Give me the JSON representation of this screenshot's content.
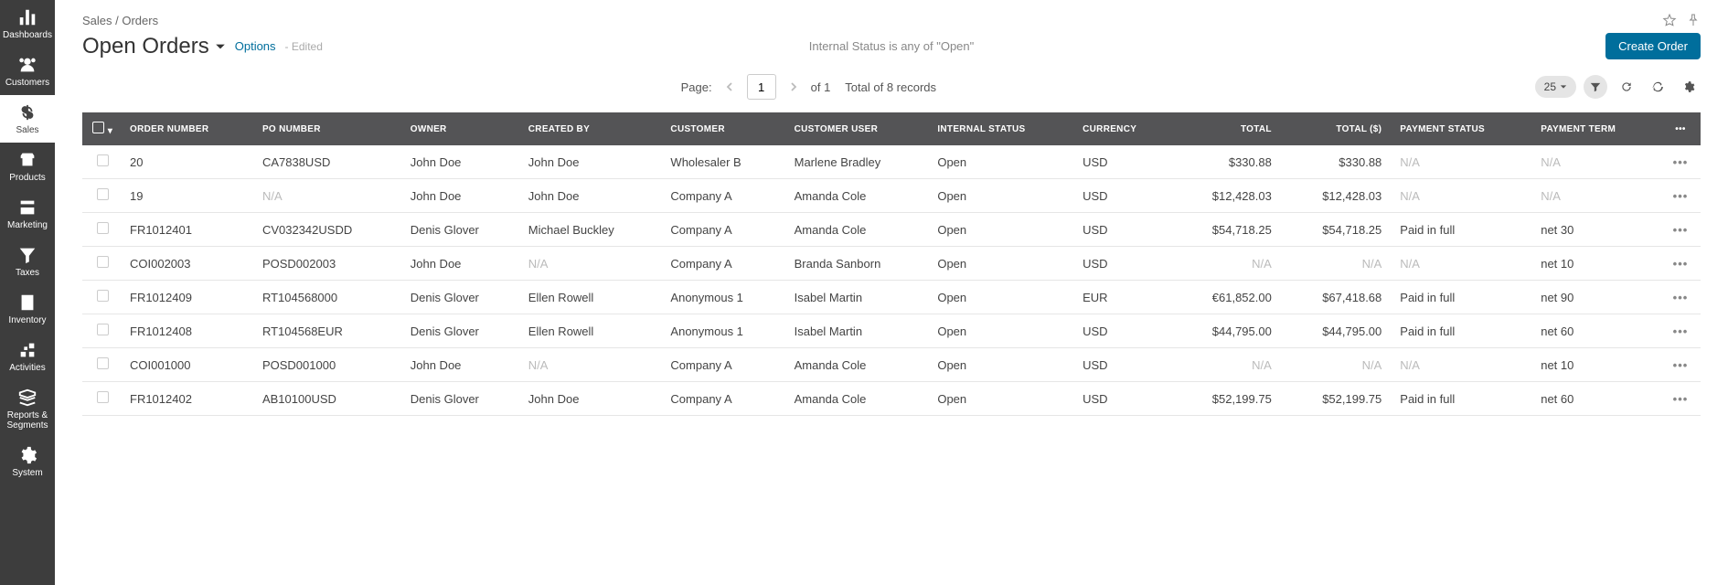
{
  "sidebar": {
    "items": [
      {
        "label": "Dashboards",
        "icon": "dashboards"
      },
      {
        "label": "Customers",
        "icon": "customers"
      },
      {
        "label": "Sales",
        "icon": "sales",
        "active": true
      },
      {
        "label": "Products",
        "icon": "products"
      },
      {
        "label": "Marketing",
        "icon": "marketing"
      },
      {
        "label": "Taxes",
        "icon": "taxes"
      },
      {
        "label": "Inventory",
        "icon": "inventory"
      },
      {
        "label": "Activities",
        "icon": "activities"
      },
      {
        "label": "Reports & Segments",
        "icon": "reports"
      },
      {
        "label": "System",
        "icon": "system"
      }
    ]
  },
  "breadcrumb": "Sales / Orders",
  "page_title": "Open Orders",
  "options_label": "Options",
  "edited_label": "- Edited",
  "filter_info": "Internal Status is any of \"Open\"",
  "create_button": "Create Order",
  "pagination": {
    "label": "Page:",
    "current": "1",
    "of": "of 1",
    "total": "Total of 8 records"
  },
  "page_size": "25",
  "table": {
    "columns": [
      "ORDER NUMBER",
      "PO NUMBER",
      "OWNER",
      "CREATED BY",
      "CUSTOMER",
      "CUSTOMER USER",
      "INTERNAL STATUS",
      "CURRENCY",
      "TOTAL",
      "TOTAL ($)",
      "PAYMENT STATUS",
      "PAYMENT TERM"
    ],
    "rows": [
      {
        "order": "20",
        "po": "CA7838USD",
        "owner": "John Doe",
        "created": "John Doe",
        "customer": "Wholesaler B",
        "user": "Marlene Bradley",
        "status": "Open",
        "currency": "USD",
        "total": "$330.88",
        "total_usd": "$330.88",
        "pay_status": "N/A",
        "term": "N/A"
      },
      {
        "order": "19",
        "po": "N/A",
        "owner": "John Doe",
        "created": "John Doe",
        "customer": "Company A",
        "user": "Amanda Cole",
        "status": "Open",
        "currency": "USD",
        "total": "$12,428.03",
        "total_usd": "$12,428.03",
        "pay_status": "N/A",
        "term": "N/A"
      },
      {
        "order": "FR1012401",
        "po": "CV032342USDD",
        "owner": "Denis Glover",
        "created": "Michael Buckley",
        "customer": "Company A",
        "user": "Amanda Cole",
        "status": "Open",
        "currency": "USD",
        "total": "$54,718.25",
        "total_usd": "$54,718.25",
        "pay_status": "Paid in full",
        "term": "net 30"
      },
      {
        "order": "COI002003",
        "po": "POSD002003",
        "owner": "John Doe",
        "created": "N/A",
        "customer": "Company A",
        "user": "Branda Sanborn",
        "status": "Open",
        "currency": "USD",
        "total": "N/A",
        "total_usd": "N/A",
        "pay_status": "N/A",
        "term": "net 10"
      },
      {
        "order": "FR1012409",
        "po": "RT104568000",
        "owner": "Denis Glover",
        "created": "Ellen Rowell",
        "customer": "Anonymous 1",
        "user": "Isabel Martin",
        "status": "Open",
        "currency": "EUR",
        "total": "€61,852.00",
        "total_usd": "$67,418.68",
        "pay_status": "Paid in full",
        "term": "net 90"
      },
      {
        "order": "FR1012408",
        "po": "RT104568EUR",
        "owner": "Denis Glover",
        "created": "Ellen Rowell",
        "customer": "Anonymous 1",
        "user": "Isabel Martin",
        "status": "Open",
        "currency": "USD",
        "total": "$44,795.00",
        "total_usd": "$44,795.00",
        "pay_status": "Paid in full",
        "term": "net 60"
      },
      {
        "order": "COI001000",
        "po": "POSD001000",
        "owner": "John Doe",
        "created": "N/A",
        "customer": "Company A",
        "user": "Amanda Cole",
        "status": "Open",
        "currency": "USD",
        "total": "N/A",
        "total_usd": "N/A",
        "pay_status": "N/A",
        "term": "net 10"
      },
      {
        "order": "FR1012402",
        "po": "AB10100USD",
        "owner": "Denis Glover",
        "created": "John Doe",
        "customer": "Company A",
        "user": "Amanda Cole",
        "status": "Open",
        "currency": "USD",
        "total": "$52,199.75",
        "total_usd": "$52,199.75",
        "pay_status": "Paid in full",
        "term": "net 60"
      }
    ]
  }
}
